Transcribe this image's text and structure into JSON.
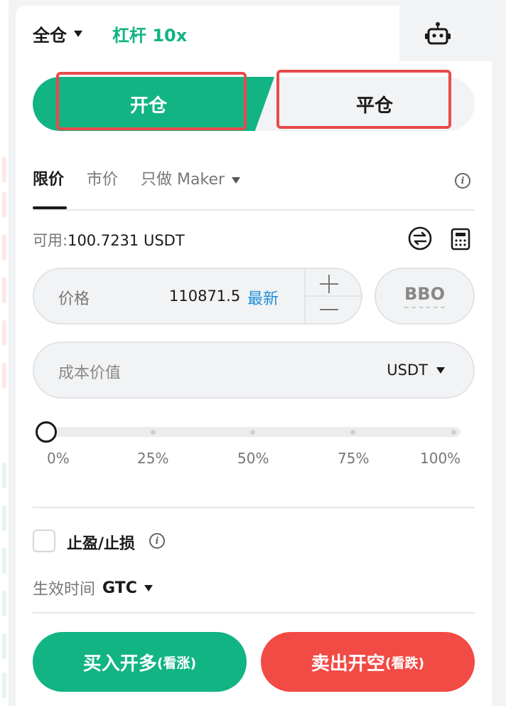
{
  "header": {
    "margin_mode": "全仓",
    "leverage": "杠杆 10x",
    "robot_icon": "robot-icon"
  },
  "position_toggle": {
    "open_label": "开仓",
    "close_label": "平仓",
    "selected": "open"
  },
  "order_types": {
    "tabs": [
      "限价",
      "市价",
      "只做 Maker"
    ],
    "active": "限价"
  },
  "available": {
    "label": "可用:",
    "value": "100.7231 USDT"
  },
  "price_input": {
    "label": "价格",
    "value": "110871.5",
    "latest_label": "最新"
  },
  "bbo_label": "BBO",
  "cost_input": {
    "placeholder": "成本价值",
    "unit": "USDT"
  },
  "slider": {
    "value_percent": 0,
    "labels": [
      "0%",
      "25%",
      "50%",
      "75%",
      "100%"
    ]
  },
  "tpsl": {
    "label": "止盈/止损",
    "checked": false
  },
  "time_in_force": {
    "label": "生效时间",
    "value": "GTC"
  },
  "actions": {
    "buy_main": "买入开多",
    "buy_sub": "(看涨)",
    "sell_main": "卖出开空",
    "sell_sub": "(看跌)"
  },
  "colors": {
    "buy": "#11b482",
    "sell": "#f24a45",
    "link": "#1e8fd6",
    "highlight": "#e84a4a"
  }
}
